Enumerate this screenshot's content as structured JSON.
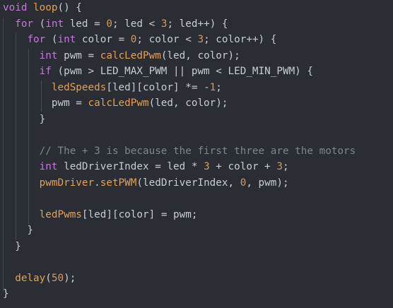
{
  "editor": {
    "language": "cpp",
    "colors": {
      "background": "#2a2d33",
      "keyword": "#c678dd",
      "function": "#e5a14f",
      "number": "#d19a66",
      "comment": "#7f848e",
      "text": "#c8ccd4",
      "indent_guide": "#454a52"
    },
    "lines": [
      [
        {
          "t": "void",
          "c": "kw"
        },
        {
          "t": " ",
          "c": "pl"
        },
        {
          "t": "loop",
          "c": "fn"
        },
        {
          "t": "() {",
          "c": "pl"
        }
      ],
      [
        {
          "t": "  ",
          "c": "pl"
        },
        {
          "t": "for",
          "c": "kw"
        },
        {
          "t": " (",
          "c": "pl"
        },
        {
          "t": "int",
          "c": "kw"
        },
        {
          "t": " led = ",
          "c": "pl"
        },
        {
          "t": "0",
          "c": "nm"
        },
        {
          "t": "; led < ",
          "c": "pl"
        },
        {
          "t": "3",
          "c": "nm"
        },
        {
          "t": "; led++) {",
          "c": "pl"
        }
      ],
      [
        {
          "t": "    ",
          "c": "pl"
        },
        {
          "t": "for",
          "c": "kw"
        },
        {
          "t": " (",
          "c": "pl"
        },
        {
          "t": "int",
          "c": "kw"
        },
        {
          "t": " color = ",
          "c": "pl"
        },
        {
          "t": "0",
          "c": "nm"
        },
        {
          "t": "; color < ",
          "c": "pl"
        },
        {
          "t": "3",
          "c": "nm"
        },
        {
          "t": "; color++) {",
          "c": "pl"
        }
      ],
      [
        {
          "t": "      ",
          "c": "pl"
        },
        {
          "t": "int",
          "c": "kw"
        },
        {
          "t": " pwm = ",
          "c": "pl"
        },
        {
          "t": "calcLedPwm",
          "c": "fn"
        },
        {
          "t": "(led, color);",
          "c": "pl"
        }
      ],
      [
        {
          "t": "      ",
          "c": "pl"
        },
        {
          "t": "if",
          "c": "kw"
        },
        {
          "t": " (pwm > LED_MAX_PWM || pwm < LED_MIN_PWM) {",
          "c": "pl"
        }
      ],
      [
        {
          "t": "        ",
          "c": "pl"
        },
        {
          "t": "ledSpeeds",
          "c": "fn"
        },
        {
          "t": "[led][color] *= -",
          "c": "pl"
        },
        {
          "t": "1",
          "c": "nm"
        },
        {
          "t": ";",
          "c": "pl"
        }
      ],
      [
        {
          "t": "        pwm = ",
          "c": "pl"
        },
        {
          "t": "calcLedPwm",
          "c": "fn"
        },
        {
          "t": "(led, color);",
          "c": "pl"
        }
      ],
      [
        {
          "t": "      }",
          "c": "pl"
        }
      ],
      [],
      [
        {
          "t": "      ",
          "c": "pl"
        },
        {
          "t": "// The + 3 is because the first three are the motors",
          "c": "cm"
        }
      ],
      [
        {
          "t": "      ",
          "c": "pl"
        },
        {
          "t": "int",
          "c": "kw"
        },
        {
          "t": " ledDriverIndex = led * ",
          "c": "pl"
        },
        {
          "t": "3",
          "c": "nm"
        },
        {
          "t": " + color + ",
          "c": "pl"
        },
        {
          "t": "3",
          "c": "nm"
        },
        {
          "t": ";",
          "c": "pl"
        }
      ],
      [
        {
          "t": "      ",
          "c": "pl"
        },
        {
          "t": "pwmDriver",
          "c": "fn"
        },
        {
          "t": ".",
          "c": "pl"
        },
        {
          "t": "setPWM",
          "c": "fn"
        },
        {
          "t": "(ledDriverIndex, ",
          "c": "pl"
        },
        {
          "t": "0",
          "c": "nm"
        },
        {
          "t": ", pwm);",
          "c": "pl"
        }
      ],
      [],
      [
        {
          "t": "      ",
          "c": "pl"
        },
        {
          "t": "ledPwms",
          "c": "fn"
        },
        {
          "t": "[led][color] = pwm;",
          "c": "pl"
        }
      ],
      [
        {
          "t": "    }",
          "c": "pl"
        }
      ],
      [
        {
          "t": "  }",
          "c": "pl"
        }
      ],
      [],
      [
        {
          "t": "  ",
          "c": "pl"
        },
        {
          "t": "delay",
          "c": "fn"
        },
        {
          "t": "(",
          "c": "pl"
        },
        {
          "t": "50",
          "c": "nm"
        },
        {
          "t": ");",
          "c": "pl"
        }
      ],
      [
        {
          "t": "}",
          "c": "pl"
        }
      ]
    ]
  }
}
